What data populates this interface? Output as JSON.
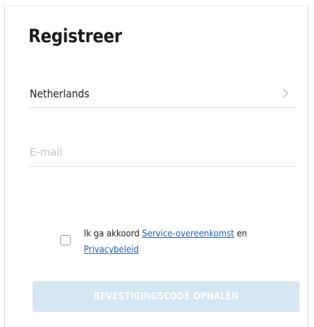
{
  "form": {
    "title": "Registreer",
    "country": {
      "value": "Netherlands",
      "icon": "chevron-right-icon"
    },
    "email": {
      "placeholder": "E-mail",
      "value": ""
    },
    "agreement": {
      "checked": false,
      "text_before": "Ik ga akkoord ",
      "link_service": "Service-overeenkomst",
      "text_between": " en",
      "link_privacy": "Privacybeleid"
    },
    "submit_label": "BEVESTIGINGSCODE OPHALEN"
  },
  "colors": {
    "link": "#1f5fae",
    "button_disabled_bg": "#d6e6f3",
    "button_text": "#ffffff",
    "placeholder": "#c3c3c3",
    "divider": "#e3e3e3"
  }
}
